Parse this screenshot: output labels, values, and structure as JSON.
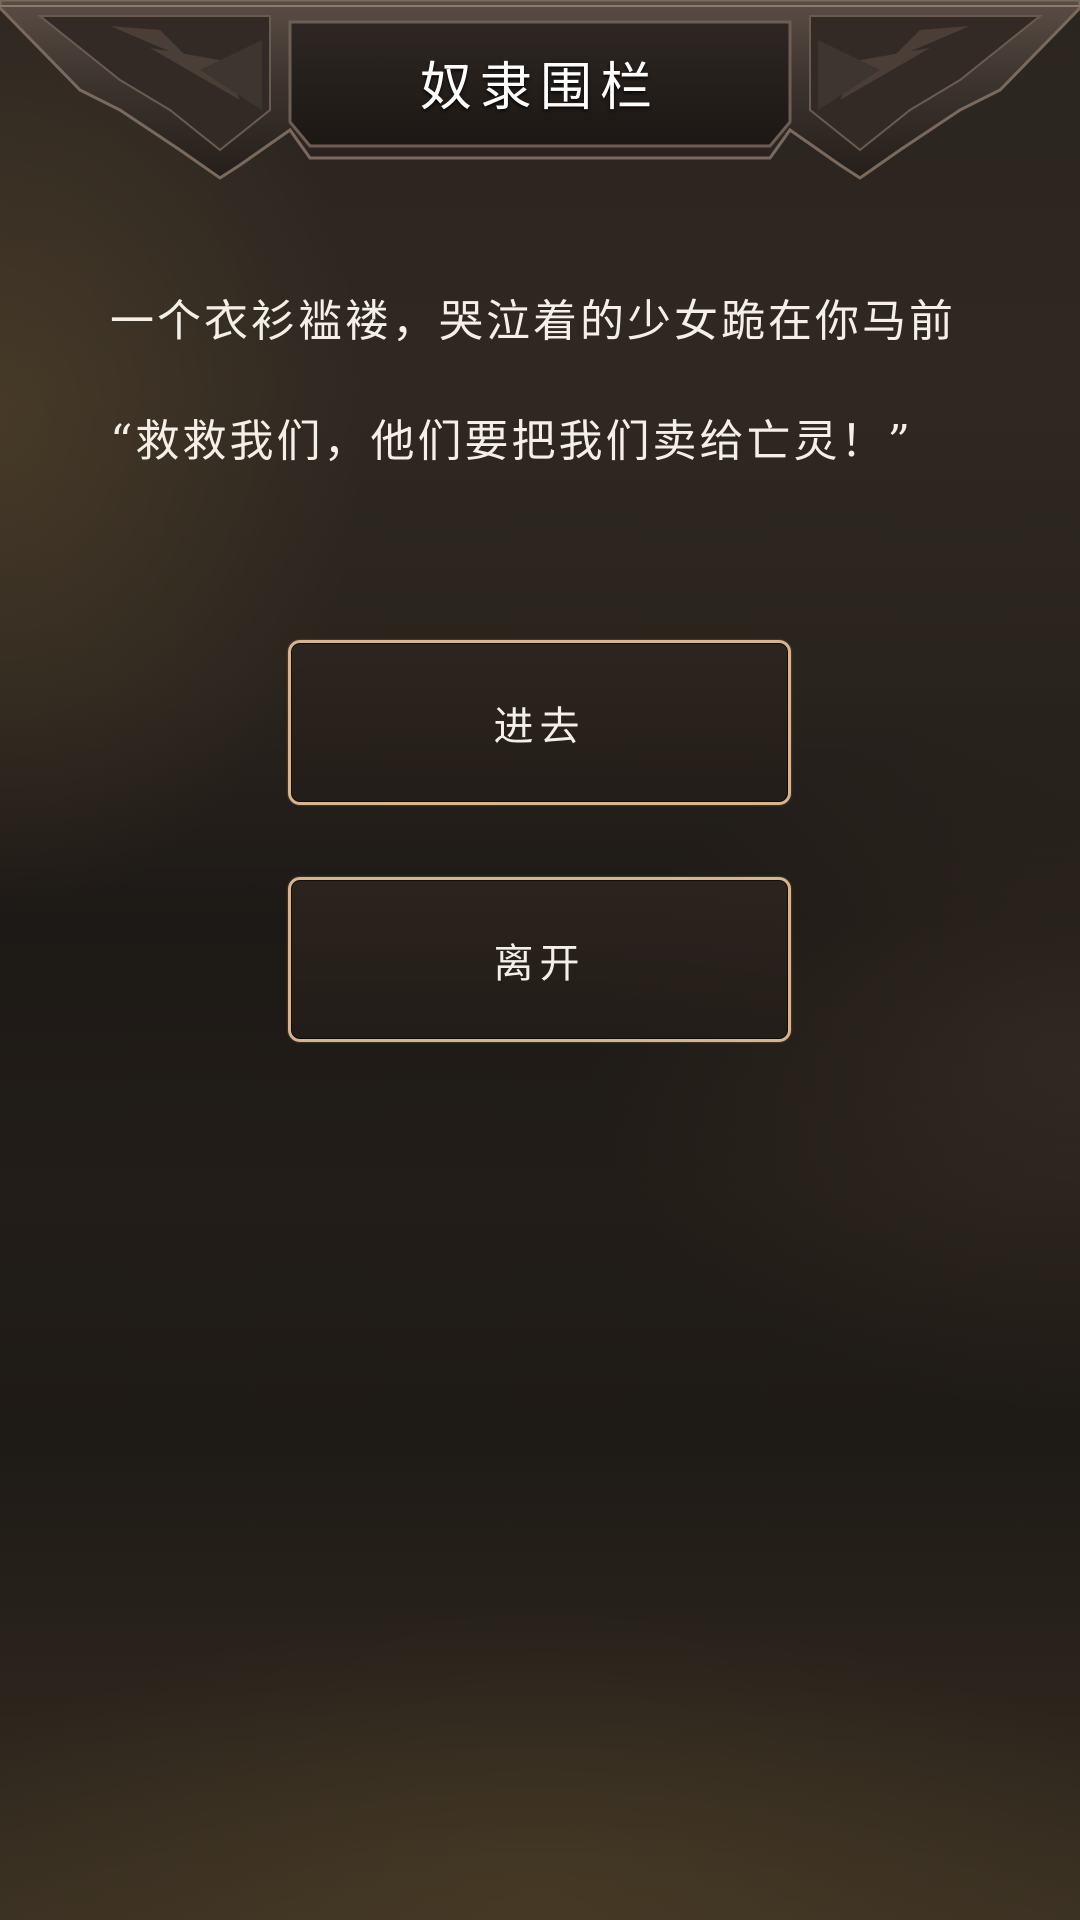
{
  "header": {
    "title": "奴隶围栏"
  },
  "story": {
    "paragraphs": [
      "一个衣衫褴褛，哭泣着的少女跪在你马前",
      "“救救我们，他们要把我们卖给亡灵！”"
    ]
  },
  "choices": [
    {
      "label": "进去"
    },
    {
      "label": "离开"
    }
  ],
  "colors": {
    "button_border": "#d8b48e",
    "text": "#f4f0e8",
    "background_dark": "#1d1916"
  }
}
